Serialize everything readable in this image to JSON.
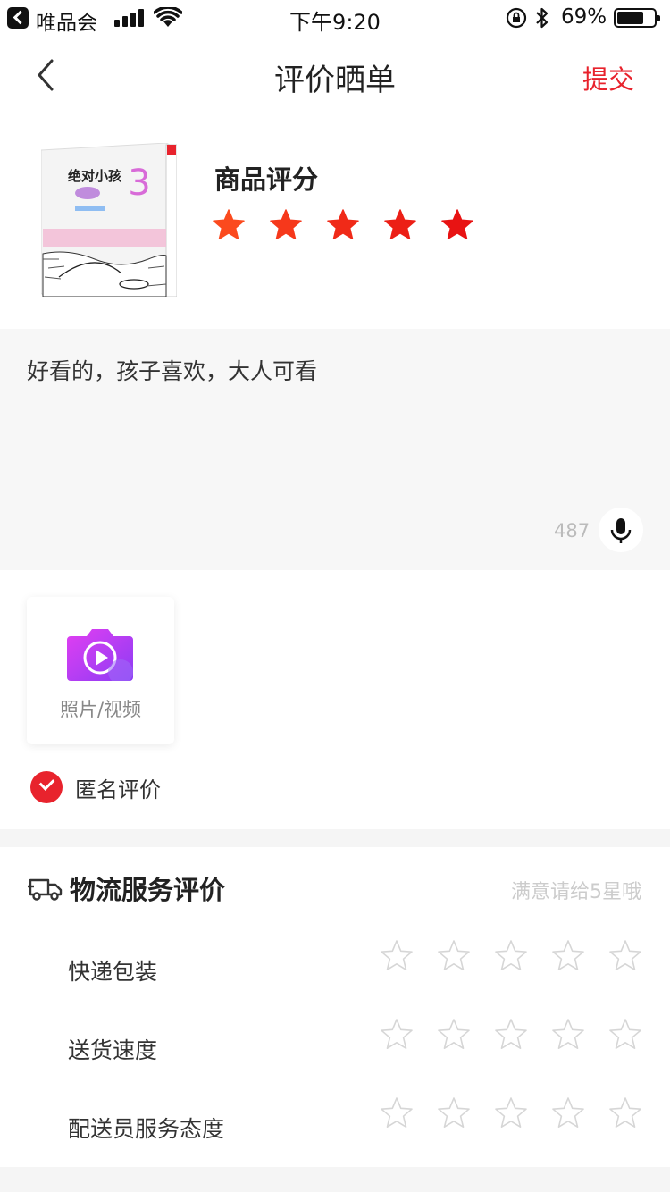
{
  "status_bar": {
    "back_app": "唯品会",
    "time": "下午9:20",
    "battery": "69%"
  },
  "nav": {
    "title": "评价晒单",
    "submit": "提交"
  },
  "product": {
    "rating_label": "商品评分",
    "rating": 5,
    "rating_max": 5,
    "star_colors": [
      "#fb4a1e",
      "#f6381b",
      "#f02a18",
      "#ec1f16",
      "#e81313"
    ],
    "book_title": "绝对小孩",
    "book_number": "3"
  },
  "comment": {
    "text": "好看的，孩子喜欢，大人可看",
    "remaining_chars": "487"
  },
  "media": {
    "upload_label": "照片/视频",
    "anonymous_label": "匿名评价",
    "anonymous_checked": true
  },
  "logistics": {
    "title": "物流服务评价",
    "hint": "满意请给5星哦",
    "rows": [
      {
        "label": "快递包装",
        "rating": 0
      },
      {
        "label": "送货速度",
        "rating": 0
      },
      {
        "label": "配送员服务态度",
        "rating": 0
      }
    ]
  },
  "colors": {
    "accent": "#e8232d",
    "empty_star": "#d6d6d6"
  }
}
